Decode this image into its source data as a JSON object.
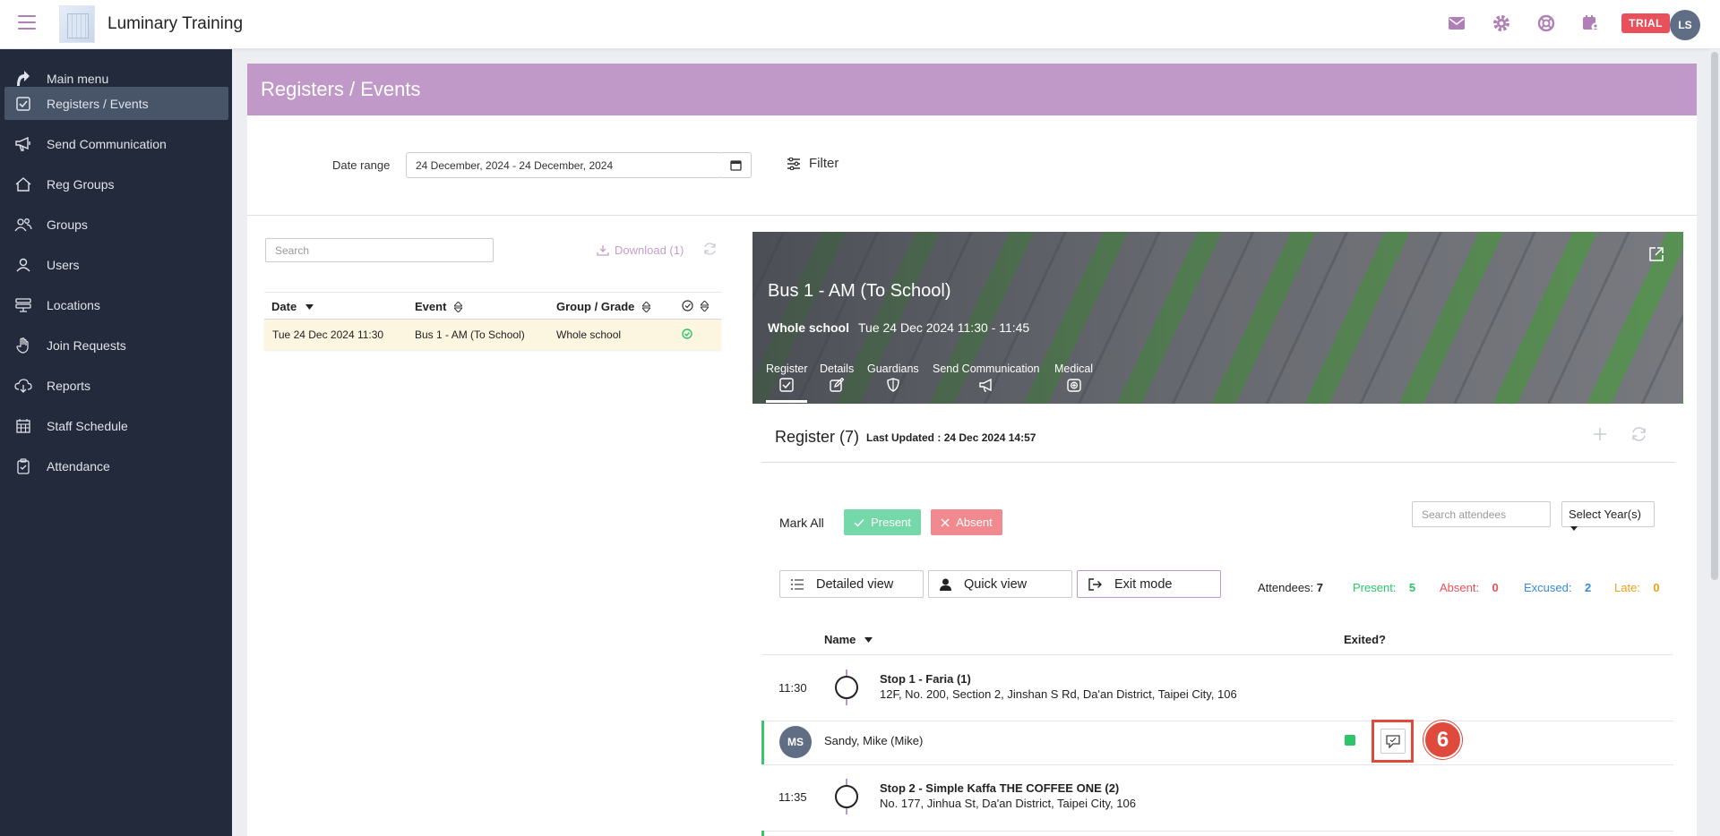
{
  "app": {
    "title": "Luminary Training",
    "trial_label": "TRIAL",
    "user_initials": "LS"
  },
  "top_icons": [
    "mail-icon",
    "gear-icon",
    "help-lifebuoy-icon",
    "calendar-user-icon"
  ],
  "sidebar": {
    "items": [
      {
        "label": "Main menu",
        "icon": "arrow-up-icon"
      },
      {
        "label": "Registers / Events",
        "icon": "checkbox-icon",
        "active": true
      },
      {
        "label": "Send Communication",
        "icon": "megaphone-icon"
      },
      {
        "label": "Reg Groups",
        "icon": "home-icon"
      },
      {
        "label": "Groups",
        "icon": "users-icon"
      },
      {
        "label": "Users",
        "icon": "user-icon"
      },
      {
        "label": "Locations",
        "icon": "locations-icon"
      },
      {
        "label": "Join Requests",
        "icon": "hand-icon"
      },
      {
        "label": "Reports",
        "icon": "cloud-download-icon"
      },
      {
        "label": "Staff Schedule",
        "icon": "calendar-grid-icon"
      },
      {
        "label": "Attendance",
        "icon": "clipboard-check-icon"
      }
    ]
  },
  "page": {
    "title": "Registers / Events"
  },
  "filters": {
    "date_label": "Date range",
    "date_value": "24 December, 2024 - 24 December, 2024",
    "filter_label": "Filter"
  },
  "events_list": {
    "search_placeholder": "Search",
    "download_label": "Download (1)",
    "columns": [
      "Date",
      "Event",
      "Group / Grade"
    ],
    "rows": [
      {
        "date": "Tue 24 Dec 2024 11:30",
        "event": "Bus 1 - AM (To School)",
        "group": "Whole school"
      }
    ]
  },
  "event": {
    "title": "Bus 1 - AM (To School)",
    "group": "Whole school",
    "time": "Tue 24 Dec 2024 11:30 - 11:45",
    "tabs": [
      "Register",
      "Details",
      "Guardians",
      "Send Communication",
      "Medical"
    ]
  },
  "register": {
    "title": "Register (7)",
    "last_updated_label": "Last Updated :",
    "last_updated_value": "24 Dec 2024 14:57",
    "mark_all_label": "Mark All",
    "present_label": "Present",
    "absent_label": "Absent",
    "search_placeholder": "Search attendees",
    "select_year_label": "Select Year(s)",
    "views": {
      "detailed": "Detailed view",
      "quick": "Quick view",
      "exit": "Exit mode"
    },
    "stats": {
      "attendees_label": "Attendees:",
      "attendees": "7",
      "present_label": "Present:",
      "present": "5",
      "absent_label": "Absent:",
      "absent": "0",
      "excused_label": "Excused:",
      "excused": "2",
      "late_label": "Late:",
      "late": "0"
    },
    "columns": {
      "name": "Name",
      "exited": "Exited?"
    },
    "stops": [
      {
        "time": "11:30",
        "name": "Stop 1 - Faria (1)",
        "address": "12F, No. 200, Section 2, Jinshan S Rd, Da'an District, Taipei City, 106"
      },
      {
        "time": "11:35",
        "name": "Stop 2 - Simple Kaffa THE COFFEE ONE (2)",
        "address": "No. 177, Jinhua St, Da'an District, Taipei City, 106"
      }
    ],
    "attendee": {
      "initials": "MS",
      "name": "Sandy, Mike (Mike)"
    },
    "step_badge": "6"
  },
  "colors": {
    "accent": "#c199c9",
    "sidebar_bg": "#232a3b",
    "present": "#2ec46b",
    "absent": "#e8505b",
    "excused": "#3a8ad8",
    "late": "#e9a21a",
    "highlight": "#e04a3c"
  }
}
